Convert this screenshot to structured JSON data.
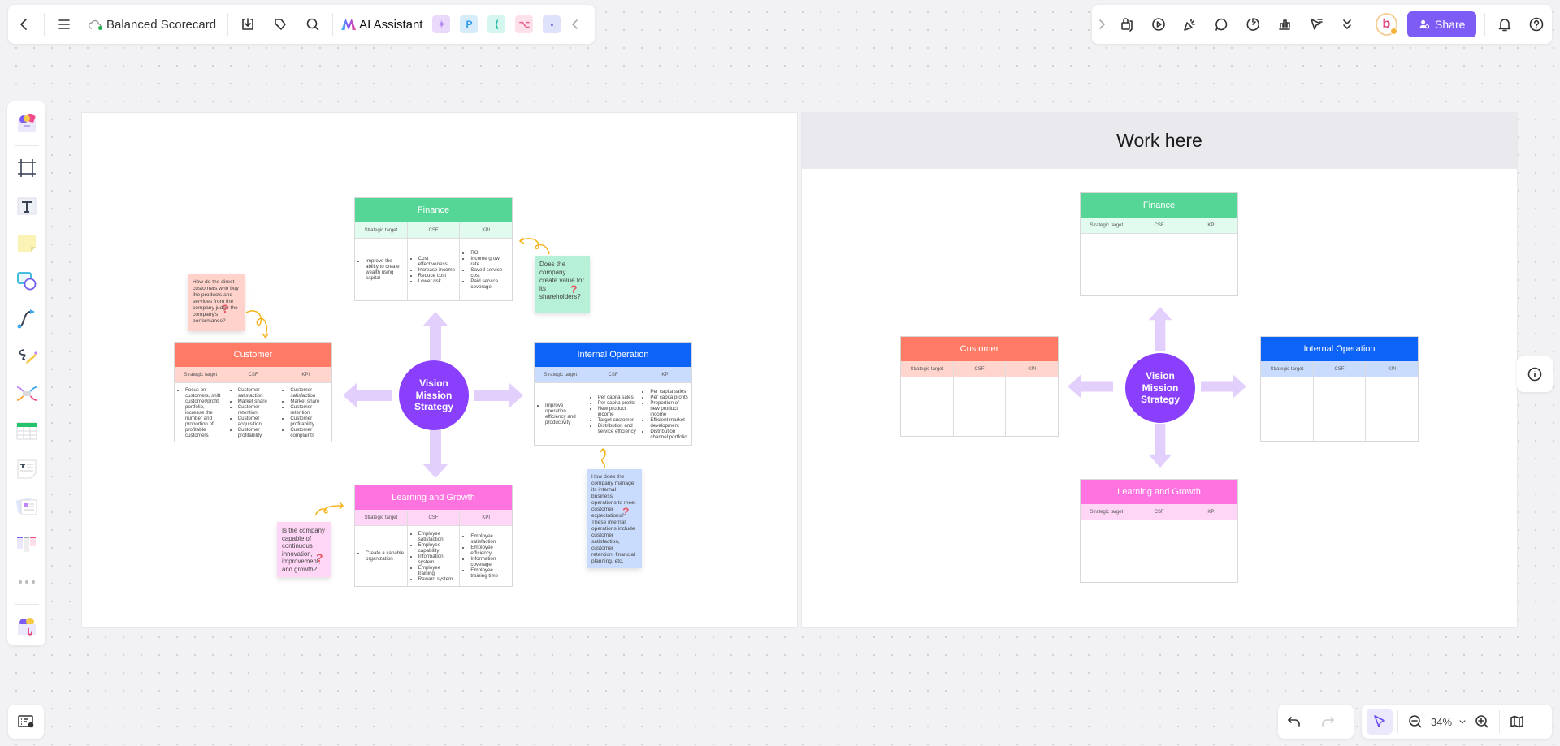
{
  "toolbar": {
    "doc_title": "Balanced Scorecard",
    "ai_label": "AI Assistant",
    "share_label": "Share",
    "avatar_letter": "b",
    "app_icons": [
      {
        "name": "ai-image-icon",
        "glyph": "✦",
        "bg": "#ead9fb",
        "fg": "#b48cf2"
      },
      {
        "name": "presentation-app-icon",
        "glyph": "P",
        "bg": "#d7ecfb",
        "fg": "#2f9ae8"
      },
      {
        "name": "mindmap-app-icon",
        "glyph": "⟨",
        "bg": "#d4f6ef",
        "fg": "#1fb8a2"
      },
      {
        "name": "flowchart-app-icon",
        "glyph": "⌥",
        "bg": "#fde0ea",
        "fg": "#ec5f91"
      },
      {
        "name": "chat-app-icon",
        "glyph": "▪",
        "bg": "#dfe2fb",
        "fg": "#7279ef"
      }
    ]
  },
  "zoom": {
    "level": "34%"
  },
  "left_frame": {
    "center": {
      "line1": "Vision",
      "line2": "Mission",
      "line3": "Strategy"
    },
    "columns": [
      "Strategic target",
      "CSF",
      "KPI"
    ],
    "cards": {
      "finance": {
        "title": "Finance",
        "color": "#55d696",
        "sub": "#e1fbef",
        "target": [
          "Improve the ability to create wealth using capital"
        ],
        "csf": [
          "Cost effectiveness",
          "Increase income",
          "Reduce cost",
          "Lower risk"
        ],
        "kpi": [
          "ROI",
          "Income grow rate",
          "Saved service cost",
          "Paid service coverage"
        ]
      },
      "customer": {
        "title": "Customer",
        "color": "#ff7b65",
        "sub": "#ffd5ce",
        "target": [
          "Focus on customers, shift customer/profit portfolio, increase the number and proportion of profitable customers"
        ],
        "csf": [
          "Customer satisfaction",
          "Market share",
          "Customer retention",
          "Customer acquisition",
          "Customer profitability"
        ],
        "kpi": [
          "Customer satisfaction",
          "Market share",
          "Customer retention",
          "Customer profitability",
          "Customer complaints"
        ]
      },
      "internal": {
        "title": "Internal Operation",
        "color": "#0d63f7",
        "sub": "#cadcfd",
        "target": [
          "Improve operation efficiency and productivity"
        ],
        "csf": [
          "Per capita sales",
          "Per capita profits",
          "New product income",
          "Target customer",
          "Distribution and service efficiency"
        ],
        "kpi": [
          "Per capita sales",
          "Per capita profits",
          "Proportion of new product income",
          "Efficient market development",
          "Distribution channel portfolio"
        ]
      },
      "learning": {
        "title": "Learning and Growth",
        "color": "#ff73e0",
        "sub": "#ffd6f6",
        "target": [
          "Create a capable organization"
        ],
        "csf": [
          "Employee satisfaction",
          "Employee capability",
          "Information system",
          "Employee training",
          "Reward system"
        ],
        "kpi": [
          "Employee satisfaction",
          "Employee efficiency",
          "Information coverage",
          "Employee training time"
        ]
      }
    },
    "notes": {
      "customer": "How do the direct customers who buy the products and services from the company judge the company's performance?",
      "finance": "Does the company create value for its shareholders?",
      "internal": "How does the company manage its internal business operations to meet customer expectations? These internal operations include customer satisfaction, customer retention, financial planning, etc.",
      "learning": "Is the company capable of continuous innovation, improvement, and growth?"
    }
  },
  "right_frame": {
    "header": "Work here",
    "center": {
      "line1": "Vision",
      "line2": "Mission",
      "line3": "Strategy"
    },
    "cards": {
      "finance": "Finance",
      "customer": "Customer",
      "internal": "Internal Operation",
      "learning": "Learning and Growth"
    }
  }
}
